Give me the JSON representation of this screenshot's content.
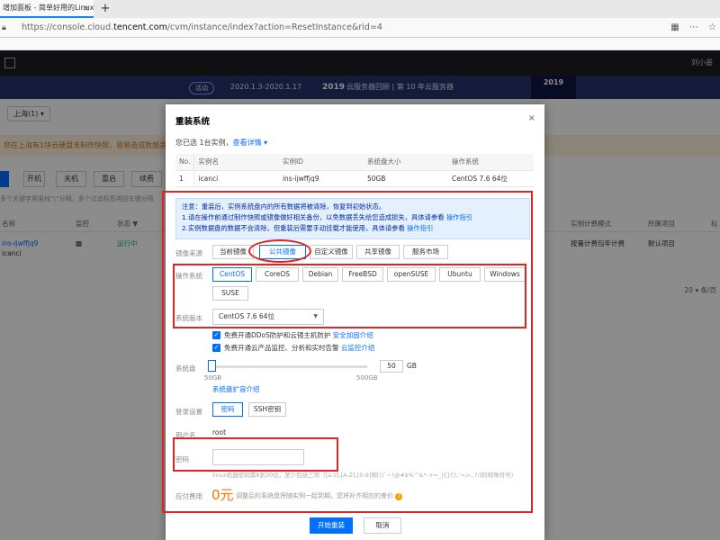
{
  "browser": {
    "tab_title": "增加面板 - 简单好用的Linux/Wi",
    "tab_close": "×",
    "new_tab": "+",
    "url_prefix": "https://console.cloud.",
    "url_domain": "tencent.com",
    "url_path": "/cvm/instance/index?action=ResetInstance&rid=4",
    "icons": [
      "qr-icon",
      "more-icon",
      "star-icon"
    ]
  },
  "console": {
    "user": "刘小墨",
    "banner": {
      "pill": "活动",
      "dates": "2020.1.3-2020.1.17",
      "year": "2019",
      "promo": "云服务器回顾 | 第 10 年云服务器",
      "badge": "2019"
    },
    "region": "上海(1) ▾",
    "notice": "您在上海有1块云硬盘未制作快照，容易造成数据丢失。",
    "toolbar": {
      "btn1": "开机",
      "btn2": "关机",
      "btn3": "重启",
      "btn4": "续费"
    },
    "search_hint": "多个关键字用竖线“|”分隔，多个过滤标签用回车键分隔",
    "table_headers": [
      "名称",
      "监控",
      "状态 ▼",
      "实例计费模式",
      "所属项目",
      "标"
    ],
    "row": {
      "name": "ins-ijwffjq9",
      "sub": "icanci",
      "status": "运行中",
      "billing": "按量计费包年计费",
      "project": "默认项目"
    },
    "pager": "20 ▾ 条/页"
  },
  "dialog": {
    "title": "重装系统",
    "close": "×",
    "selected_text": "您已选 1台实例，",
    "selected_link": "查看详情 ▾",
    "table": {
      "headers": [
        "No.",
        "实例名",
        "实例ID",
        "系统盘大小",
        "操作系统"
      ],
      "row": [
        "1",
        "icanci",
        "ins-ijwffjq9",
        "50GB",
        "CentOS 7.6 64位"
      ]
    },
    "warning": {
      "line1": "注意：重装后，实例系统盘内的所有数据将被清除，恢复到初始状态。",
      "line2": "1.请在操作前通过制作快照或镜像做好相关备份，以免数据丢失给您造成损失，具体请参看",
      "line3": "2.实例数据盘的数据不会清除，但重装后需要手动挂载才能使用，具体请参看",
      "link": "操作指引"
    },
    "image_source": {
      "label": "镜像来源",
      "options": [
        "当前镜像",
        "公共镜像",
        "自定义镜像",
        "共享镜像",
        "服务市场"
      ],
      "selected": "公共镜像"
    },
    "os": {
      "label": "操作系统",
      "options": [
        "CentOS",
        "CoreOS",
        "Debian",
        "FreeBSD",
        "openSUSE",
        "Ubuntu",
        "Windows",
        "SUSE"
      ],
      "selected": "CentOS"
    },
    "version": {
      "label": "系统版本",
      "value": "CentOS 7.6 64位"
    },
    "checks": {
      "c1_text": "免费开通DDoS防护和云镜主机防护",
      "c1_link": "安全加固介绍",
      "c2_text": "免费开通云产品监控、分析和实时告警",
      "c2_link": "云监控介绍"
    },
    "disk": {
      "label": "系统盘",
      "value": "50",
      "unit": "GB",
      "min": "50GB",
      "max": "500GB",
      "level": 0.0,
      "link": "系统盘扩容介绍"
    },
    "login": {
      "label": "登录设置",
      "options": [
        "密码",
        "SSH密钥"
      ],
      "selected": "密码"
    },
    "username": {
      "label": "用户名",
      "value": "root"
    },
    "password": {
      "label": "密码",
      "hint": "linux机器密码需8到30位，至少包括三项（[a-z],[A-Z],[0-9]和[()`~!@#$%^&*-+=_|{}[]:;'<>,.?/]的特殊符号）"
    },
    "fee": {
      "label": "应付费用",
      "value": "0元",
      "note": "调整后的系统盘将随实例一起到期，您将补齐相应的差价",
      "info": "i"
    },
    "buttons": {
      "ok": "开始重装",
      "cancel": "取消"
    }
  },
  "colors": {
    "accent": "#006eff",
    "annotation": "#e02424",
    "price": "#ff7200"
  }
}
